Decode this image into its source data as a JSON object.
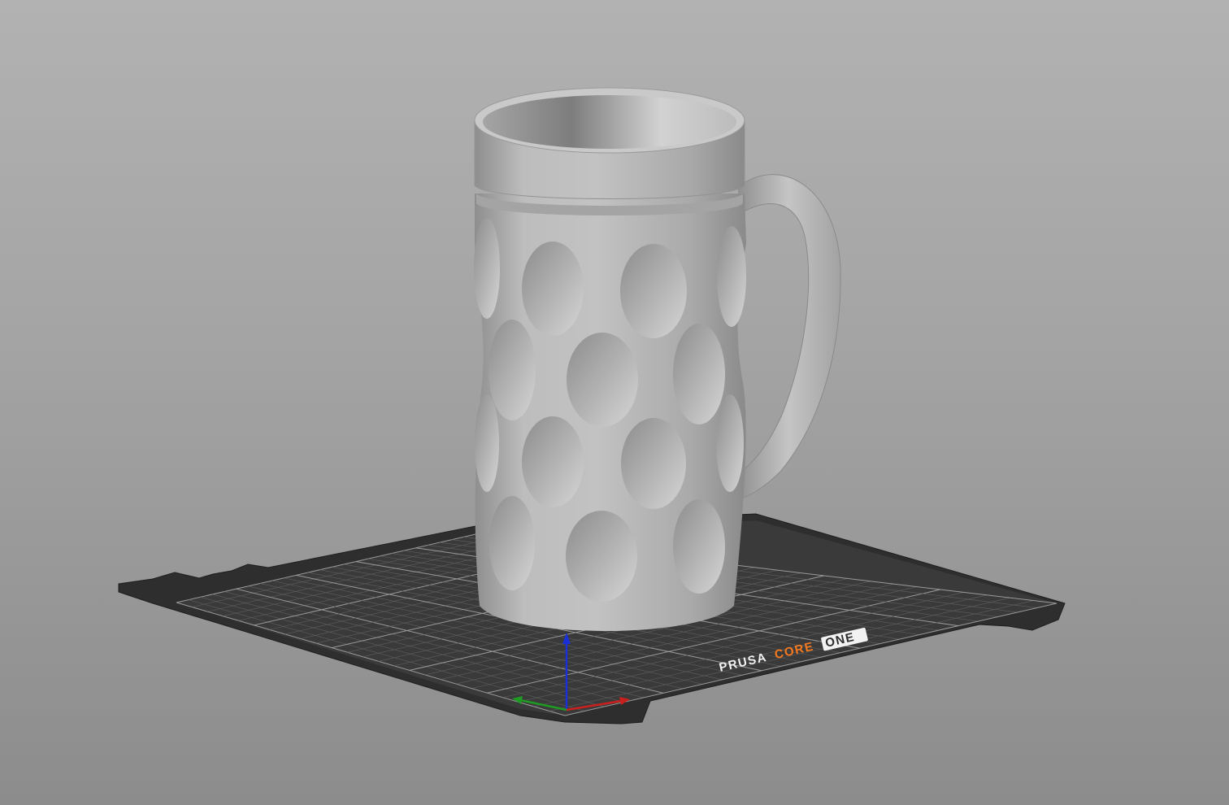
{
  "viewport": {
    "background_top": "#b2b2b2",
    "background_bottom": "#8c8c8c"
  },
  "bed": {
    "brand": "PRUSA",
    "model_word1": "CORE",
    "model_word2": "ONE",
    "surface_color": "#2d2d2d",
    "grid_color": "#6e6e6e",
    "accent_color": "#f47a20"
  },
  "axes": {
    "x_color": "#c8201e",
    "y_color": "#1f9a22",
    "z_color": "#1a2fd6"
  },
  "model": {
    "object": "beer-mug",
    "color": "#b7b7b7"
  }
}
